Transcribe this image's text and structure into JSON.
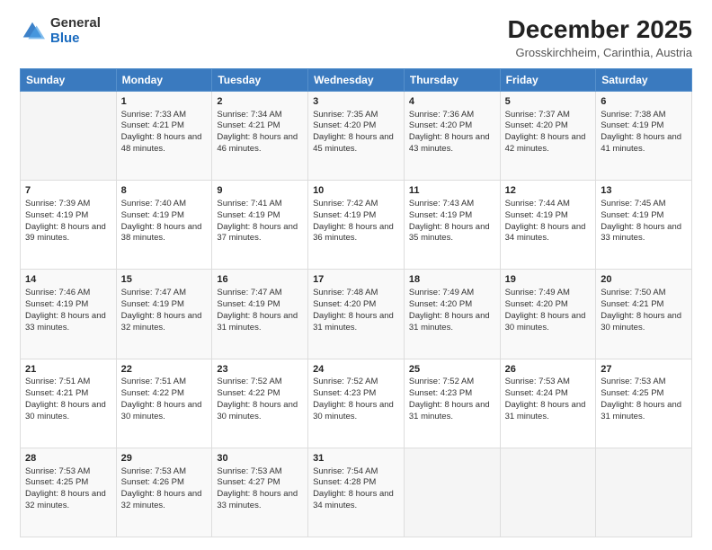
{
  "logo": {
    "general": "General",
    "blue": "Blue"
  },
  "header": {
    "month_year": "December 2025",
    "location": "Grosskirchheim, Carinthia, Austria"
  },
  "days_of_week": [
    "Sunday",
    "Monday",
    "Tuesday",
    "Wednesday",
    "Thursday",
    "Friday",
    "Saturday"
  ],
  "weeks": [
    [
      {
        "day": "",
        "sunrise": "",
        "sunset": "",
        "daylight": ""
      },
      {
        "day": "1",
        "sunrise": "Sunrise: 7:33 AM",
        "sunset": "Sunset: 4:21 PM",
        "daylight": "Daylight: 8 hours and 48 minutes."
      },
      {
        "day": "2",
        "sunrise": "Sunrise: 7:34 AM",
        "sunset": "Sunset: 4:21 PM",
        "daylight": "Daylight: 8 hours and 46 minutes."
      },
      {
        "day": "3",
        "sunrise": "Sunrise: 7:35 AM",
        "sunset": "Sunset: 4:20 PM",
        "daylight": "Daylight: 8 hours and 45 minutes."
      },
      {
        "day": "4",
        "sunrise": "Sunrise: 7:36 AM",
        "sunset": "Sunset: 4:20 PM",
        "daylight": "Daylight: 8 hours and 43 minutes."
      },
      {
        "day": "5",
        "sunrise": "Sunrise: 7:37 AM",
        "sunset": "Sunset: 4:20 PM",
        "daylight": "Daylight: 8 hours and 42 minutes."
      },
      {
        "day": "6",
        "sunrise": "Sunrise: 7:38 AM",
        "sunset": "Sunset: 4:19 PM",
        "daylight": "Daylight: 8 hours and 41 minutes."
      }
    ],
    [
      {
        "day": "7",
        "sunrise": "Sunrise: 7:39 AM",
        "sunset": "Sunset: 4:19 PM",
        "daylight": "Daylight: 8 hours and 39 minutes."
      },
      {
        "day": "8",
        "sunrise": "Sunrise: 7:40 AM",
        "sunset": "Sunset: 4:19 PM",
        "daylight": "Daylight: 8 hours and 38 minutes."
      },
      {
        "day": "9",
        "sunrise": "Sunrise: 7:41 AM",
        "sunset": "Sunset: 4:19 PM",
        "daylight": "Daylight: 8 hours and 37 minutes."
      },
      {
        "day": "10",
        "sunrise": "Sunrise: 7:42 AM",
        "sunset": "Sunset: 4:19 PM",
        "daylight": "Daylight: 8 hours and 36 minutes."
      },
      {
        "day": "11",
        "sunrise": "Sunrise: 7:43 AM",
        "sunset": "Sunset: 4:19 PM",
        "daylight": "Daylight: 8 hours and 35 minutes."
      },
      {
        "day": "12",
        "sunrise": "Sunrise: 7:44 AM",
        "sunset": "Sunset: 4:19 PM",
        "daylight": "Daylight: 8 hours and 34 minutes."
      },
      {
        "day": "13",
        "sunrise": "Sunrise: 7:45 AM",
        "sunset": "Sunset: 4:19 PM",
        "daylight": "Daylight: 8 hours and 33 minutes."
      }
    ],
    [
      {
        "day": "14",
        "sunrise": "Sunrise: 7:46 AM",
        "sunset": "Sunset: 4:19 PM",
        "daylight": "Daylight: 8 hours and 33 minutes."
      },
      {
        "day": "15",
        "sunrise": "Sunrise: 7:47 AM",
        "sunset": "Sunset: 4:19 PM",
        "daylight": "Daylight: 8 hours and 32 minutes."
      },
      {
        "day": "16",
        "sunrise": "Sunrise: 7:47 AM",
        "sunset": "Sunset: 4:19 PM",
        "daylight": "Daylight: 8 hours and 31 minutes."
      },
      {
        "day": "17",
        "sunrise": "Sunrise: 7:48 AM",
        "sunset": "Sunset: 4:20 PM",
        "daylight": "Daylight: 8 hours and 31 minutes."
      },
      {
        "day": "18",
        "sunrise": "Sunrise: 7:49 AM",
        "sunset": "Sunset: 4:20 PM",
        "daylight": "Daylight: 8 hours and 31 minutes."
      },
      {
        "day": "19",
        "sunrise": "Sunrise: 7:49 AM",
        "sunset": "Sunset: 4:20 PM",
        "daylight": "Daylight: 8 hours and 30 minutes."
      },
      {
        "day": "20",
        "sunrise": "Sunrise: 7:50 AM",
        "sunset": "Sunset: 4:21 PM",
        "daylight": "Daylight: 8 hours and 30 minutes."
      }
    ],
    [
      {
        "day": "21",
        "sunrise": "Sunrise: 7:51 AM",
        "sunset": "Sunset: 4:21 PM",
        "daylight": "Daylight: 8 hours and 30 minutes."
      },
      {
        "day": "22",
        "sunrise": "Sunrise: 7:51 AM",
        "sunset": "Sunset: 4:22 PM",
        "daylight": "Daylight: 8 hours and 30 minutes."
      },
      {
        "day": "23",
        "sunrise": "Sunrise: 7:52 AM",
        "sunset": "Sunset: 4:22 PM",
        "daylight": "Daylight: 8 hours and 30 minutes."
      },
      {
        "day": "24",
        "sunrise": "Sunrise: 7:52 AM",
        "sunset": "Sunset: 4:23 PM",
        "daylight": "Daylight: 8 hours and 30 minutes."
      },
      {
        "day": "25",
        "sunrise": "Sunrise: 7:52 AM",
        "sunset": "Sunset: 4:23 PM",
        "daylight": "Daylight: 8 hours and 31 minutes."
      },
      {
        "day": "26",
        "sunrise": "Sunrise: 7:53 AM",
        "sunset": "Sunset: 4:24 PM",
        "daylight": "Daylight: 8 hours and 31 minutes."
      },
      {
        "day": "27",
        "sunrise": "Sunrise: 7:53 AM",
        "sunset": "Sunset: 4:25 PM",
        "daylight": "Daylight: 8 hours and 31 minutes."
      }
    ],
    [
      {
        "day": "28",
        "sunrise": "Sunrise: 7:53 AM",
        "sunset": "Sunset: 4:25 PM",
        "daylight": "Daylight: 8 hours and 32 minutes."
      },
      {
        "day": "29",
        "sunrise": "Sunrise: 7:53 AM",
        "sunset": "Sunset: 4:26 PM",
        "daylight": "Daylight: 8 hours and 32 minutes."
      },
      {
        "day": "30",
        "sunrise": "Sunrise: 7:53 AM",
        "sunset": "Sunset: 4:27 PM",
        "daylight": "Daylight: 8 hours and 33 minutes."
      },
      {
        "day": "31",
        "sunrise": "Sunrise: 7:54 AM",
        "sunset": "Sunset: 4:28 PM",
        "daylight": "Daylight: 8 hours and 34 minutes."
      },
      {
        "day": "",
        "sunrise": "",
        "sunset": "",
        "daylight": ""
      },
      {
        "day": "",
        "sunrise": "",
        "sunset": "",
        "daylight": ""
      },
      {
        "day": "",
        "sunrise": "",
        "sunset": "",
        "daylight": ""
      }
    ]
  ]
}
